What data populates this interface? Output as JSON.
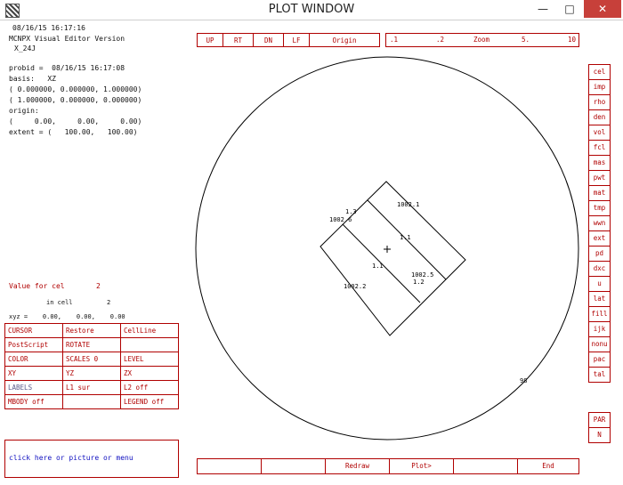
{
  "window": {
    "title": "PLOT WINDOW",
    "minimize": "—",
    "maximize": "□",
    "close": "✕"
  },
  "header": {
    "timestamp": "08/16/15 16:17:16",
    "app": "MCNPX Visual Editor Version",
    "version": "X_24J"
  },
  "info": {
    "probid": "probid =  08/16/15 16:17:08",
    "basis_label": "basis:   XZ",
    "basis_1": "( 0.000000, 0.000000, 1.000000)",
    "basis_2": "( 1.000000, 0.000000, 0.000000)",
    "origin_label": "origin:",
    "origin": "(     0.00,     0.00,     0.00)",
    "extent": "extent = (   100.00,   100.00)"
  },
  "value": {
    "label": "Value for cel",
    "number": "2",
    "in_cell": "in cell",
    "in_cell_value": "2",
    "xyz": "xyz =    0.00,    0.00,    0.00"
  },
  "top_nav": [
    "UP",
    "RT",
    "DN",
    "LF",
    "Origin"
  ],
  "zoom": {
    "min": ".1",
    "mid": ".2",
    "label": "Zoom",
    "five": "5.",
    "max": "10"
  },
  "menu": [
    [
      "CURSOR",
      "Restore",
      "CellLine"
    ],
    [
      "PostScript",
      "ROTATE",
      ""
    ],
    [
      "COLOR",
      "SCALES 0",
      "LEVEL"
    ],
    [
      "XY",
      "YZ",
      "ZX"
    ],
    [
      "LABELS",
      "L1 sur",
      "L2 off"
    ],
    [
      "MBODY off",
      "",
      "LEGEND off"
    ]
  ],
  "message": "click here or picture or menu",
  "bottom_bar": [
    "",
    "",
    "Redraw",
    "Plot>",
    "",
    "End"
  ],
  "right_panel": [
    "cel",
    "imp",
    "rho",
    "den",
    "vol",
    "fcl",
    "mas",
    "pwt",
    "mat",
    "tmp",
    "wwn",
    "ext",
    "pd",
    "dxc",
    "u",
    "lat",
    "fill",
    "ijk",
    "nonu",
    "pac",
    "tal"
  ],
  "right_bottom": [
    "PAR",
    "N"
  ],
  "plot_labels": {
    "l1": "1.3",
    "l2": "1002.6",
    "l3": "1002.1",
    "l4": "1.1",
    "l5": "1.1",
    "l6": "1002.5",
    "l7": "1.2",
    "l8": "1002.2",
    "l9": "98"
  },
  "colors": {
    "menu_red": "#b00000",
    "message_blue": "#1010c0",
    "close_red": "#c7403a"
  }
}
